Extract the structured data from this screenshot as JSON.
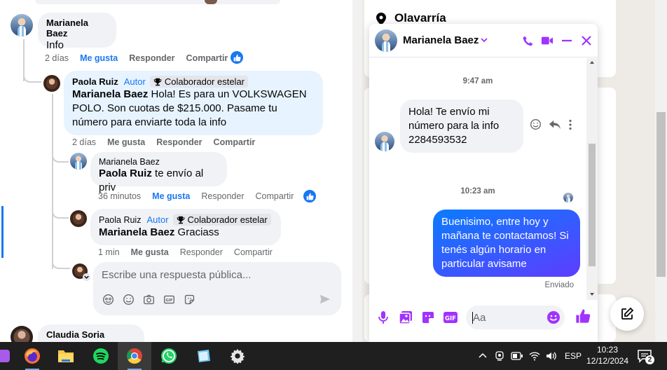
{
  "feed": {
    "comments": [
      {
        "author": "Marianela Baez",
        "text": "Info",
        "time": "2 días",
        "like": "Me gusta",
        "reply": "Responder",
        "share": "Compartir"
      },
      {
        "author": "Paola Ruiz",
        "role": "Autor",
        "badge": "Colaborador estelar",
        "mention": "Marianela Baez",
        "text": " Hola! Es para un VOLKSWAGEN POLO. Son cuotas de $215.000. Pasame tu número para enviarte toda la info",
        "time": "2 días",
        "like": "Me gusta",
        "reply": "Responder",
        "share": "Compartir"
      },
      {
        "author": "Marianela Baez",
        "mention": "Paola Ruiz",
        "text": " te envío al priv",
        "time": "36 minutos",
        "like": "Me gusta",
        "reply": "Responder",
        "share": "Compartir"
      },
      {
        "author": "Paola Ruiz",
        "role": "Autor",
        "badge": "Colaborador estelar",
        "mention": "Marianela Baez",
        "text": " Graciass",
        "time": "1 min",
        "like": "Me gusta",
        "reply": "Responder",
        "share": "Compartir"
      },
      {
        "author": "Claudia Soria"
      }
    ],
    "reply_placeholder": "Escribe una respuesta pública..."
  },
  "page": {
    "location": "Olavarría"
  },
  "chat": {
    "contact_name": "Marianela Baez",
    "timestamp_1": "9:47 am",
    "incoming_message": "Hola! Te envío mi número para la info 2284593532",
    "timestamp_2": "10:23 am",
    "outgoing_message": "Buenisimo, entre hoy y mañana te contactamos! Si tenés algún horario en particular avisame",
    "status": "Enviado",
    "input_placeholder": "Aa",
    "accent_color": "#a033ff",
    "messenger_blue": "#0a7cff"
  },
  "taskbar": {
    "apps": [
      "firefox-icon",
      "file-explorer-icon",
      "spotify-icon",
      "chrome-icon",
      "whatsapp-icon",
      "notes-icon",
      "settings-icon"
    ],
    "language": "ESP",
    "time": "10:23",
    "date": "12/12/2024",
    "notifications": "2"
  },
  "colors": {
    "facebook_blue": "#1877f2",
    "comment_bg": "#f0f2f5",
    "highlight_bg": "#e7f3ff",
    "taskbar_bg": "#1f1f1f"
  }
}
